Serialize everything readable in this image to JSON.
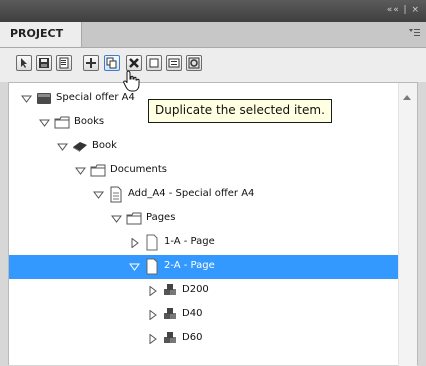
{
  "window": {
    "controls": "«« | ×",
    "tab_label": "PROJECT"
  },
  "toolbar": {
    "buttons": [
      {
        "name": "select-tool-icon"
      },
      {
        "name": "save-icon"
      },
      {
        "name": "properties-icon"
      },
      {
        "name": "add-item-icon"
      },
      {
        "name": "duplicate-icon"
      },
      {
        "name": "delete-icon"
      },
      {
        "name": "page-icon"
      },
      {
        "name": "list-icon"
      },
      {
        "name": "refresh-icon"
      }
    ]
  },
  "tooltip": {
    "text": "Duplicate the selected item."
  },
  "tree": {
    "items": [
      {
        "label": "Special offer A4",
        "level": 0,
        "icon": "catalog-book-icon",
        "expanded": true
      },
      {
        "label": "Books",
        "level": 1,
        "icon": "folder-icon",
        "expanded": true
      },
      {
        "label": "Book",
        "level": 2,
        "icon": "book-icon",
        "expanded": true
      },
      {
        "label": "Documents",
        "level": 3,
        "icon": "folder-icon",
        "expanded": true
      },
      {
        "label": "Add_A4 - Special offer A4",
        "level": 4,
        "icon": "document-icon",
        "expanded": true
      },
      {
        "label": "Pages",
        "level": 5,
        "icon": "folder-icon",
        "expanded": true
      },
      {
        "label": "1-A - Page",
        "level": 6,
        "icon": "page-icon",
        "expanded": false
      },
      {
        "label": "2-A - Page",
        "level": 6,
        "icon": "page-icon",
        "expanded": true,
        "selected": true
      },
      {
        "label": "D200",
        "level": 7,
        "icon": "product-group-icon",
        "expanded": false
      },
      {
        "label": "D40",
        "level": 7,
        "icon": "product-group-icon",
        "expanded": false
      },
      {
        "label": "D60",
        "level": 7,
        "icon": "product-group-icon",
        "expanded": false
      }
    ]
  },
  "colors": {
    "selection": "#3399ff",
    "tooltip_bg": "#ffffe1",
    "titlebar": "#4a4a4a"
  }
}
